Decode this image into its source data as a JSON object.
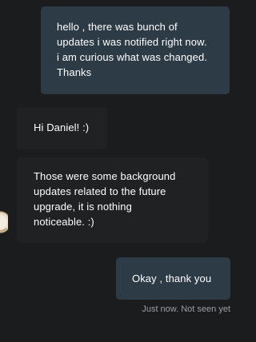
{
  "messages": [
    {
      "direction": "outgoing",
      "lines": [
        "hello , there was bunch of",
        "updates i was notified right now.",
        "i am curious what was changed.",
        "Thanks"
      ]
    },
    {
      "direction": "incoming",
      "lines": [
        "Hi Daniel! :)"
      ]
    },
    {
      "direction": "incoming",
      "lines": [
        "Those were some background",
        "updates related to the future",
        "upgrade, it is nothing",
        "noticeable. :)"
      ]
    },
    {
      "direction": "outgoing",
      "lines": [
        "Okay , thank you"
      ]
    }
  ],
  "delivery_status": "Just now. Not seen yet",
  "colors": {
    "background": "#1b1c1e",
    "outgoing_bubble": "#2d3b47",
    "incoming_bubble": "#202123",
    "status_text": "#9a9ea4"
  },
  "icons": {
    "agent_avatar": "agent-avatar-icon"
  }
}
